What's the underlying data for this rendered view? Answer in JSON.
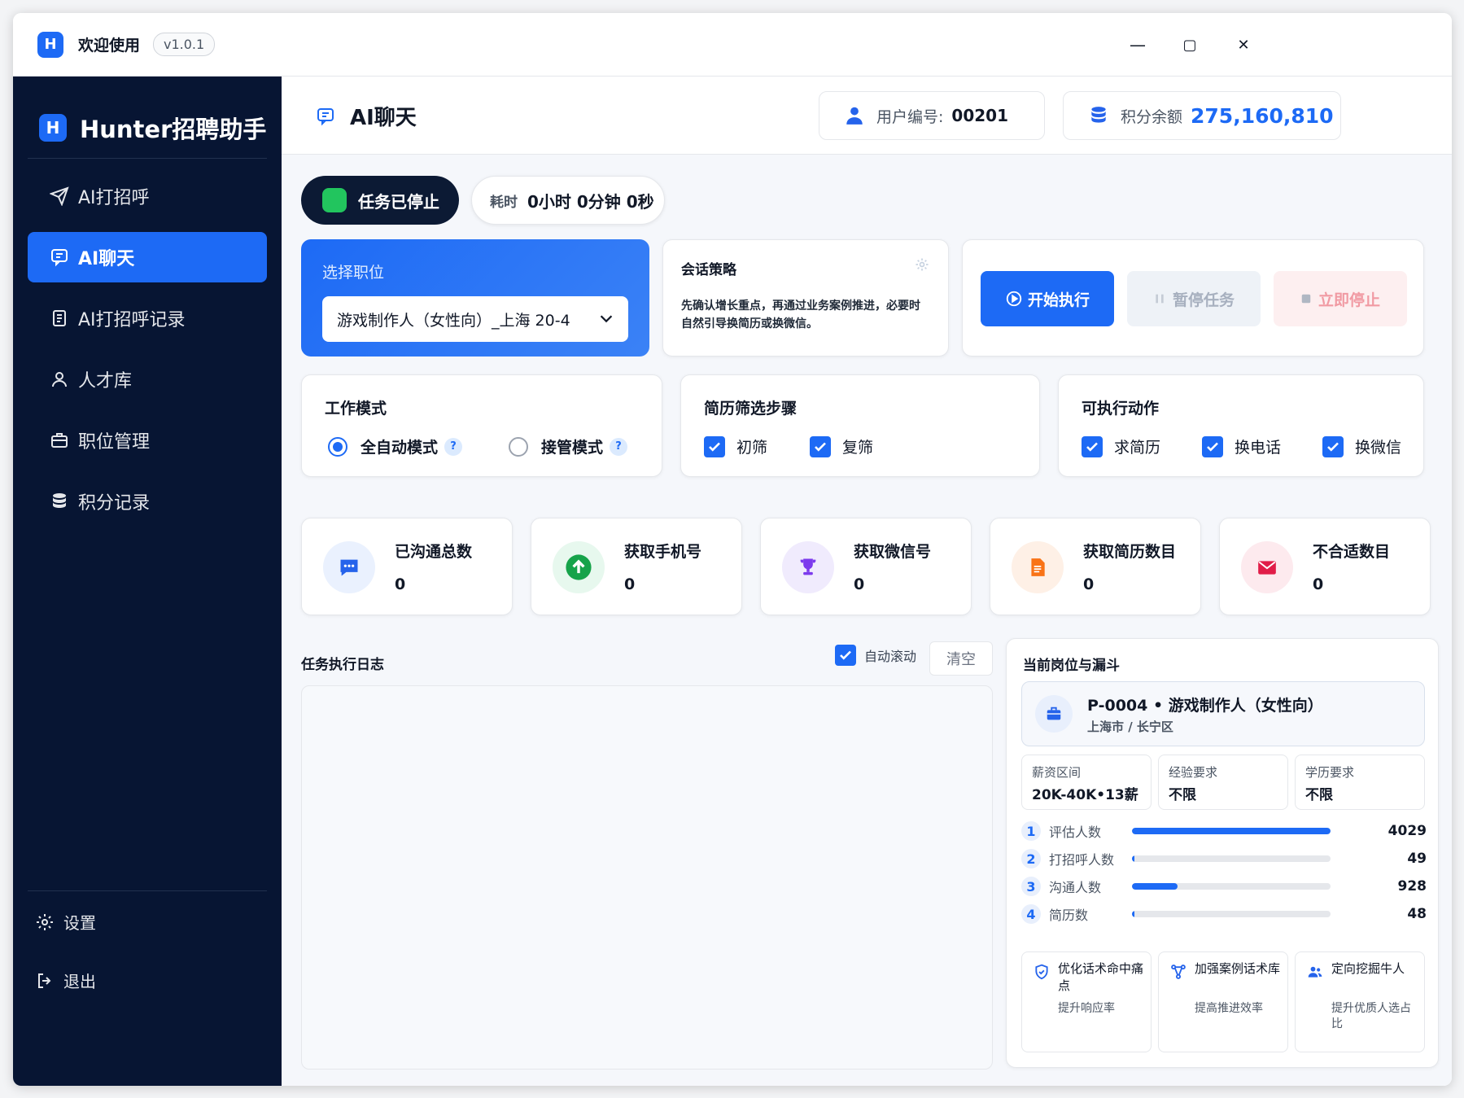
{
  "titlebar": {
    "title": "欢迎使用",
    "version": "v1.0.1",
    "minimize": "—",
    "maximize": "▢",
    "close": "✕"
  },
  "sidebar": {
    "brand": "Hunter招聘助手",
    "items": [
      {
        "label": "AI打招呼",
        "icon": "send-icon"
      },
      {
        "label": "AI聊天",
        "icon": "chat-icon"
      },
      {
        "label": "AI打招呼记录",
        "icon": "document-icon"
      },
      {
        "label": "人才库",
        "icon": "user-icon"
      },
      {
        "label": "职位管理",
        "icon": "briefcase-icon"
      },
      {
        "label": "积分记录",
        "icon": "database-icon"
      }
    ],
    "active_index": 1,
    "settings": "设置",
    "logout": "退出"
  },
  "header": {
    "title": "AI聊天",
    "user_label": "用户编号:",
    "user_id": "00201",
    "points_label": "积分余额",
    "points_value": "275,160,810"
  },
  "task": {
    "status": "任务已停止",
    "elapsed_label": "耗时",
    "elapsed_value": "0小时 0分钟 0秒"
  },
  "job_select": {
    "label": "选择职位",
    "value": "游戏制作人（女性向）_上海 20-4"
  },
  "strategy": {
    "title": "会话策略",
    "text": "先确认增长重点，再通过业务案例推进，必要时自然引导换简历或换微信。"
  },
  "actions": {
    "start": "开始执行",
    "pause": "暂停任务",
    "stop": "立即停止"
  },
  "work_mode": {
    "title": "工作模式",
    "options": [
      "全自动模式",
      "接管模式"
    ],
    "help": "?",
    "selected": 0
  },
  "resume_steps": {
    "title": "简历筛选步骤",
    "options": [
      "初筛",
      "复筛"
    ]
  },
  "exec_actions": {
    "title": "可执行动作",
    "options": [
      "求简历",
      "换电话",
      "换微信"
    ]
  },
  "stats": [
    {
      "title": "已沟通总数",
      "value": "0",
      "color": "#2563eb",
      "bg": "#eaf1fe"
    },
    {
      "title": "获取手机号",
      "value": "0",
      "color": "#16a34a",
      "bg": "#e7f8ee"
    },
    {
      "title": "获取微信号",
      "value": "0",
      "color": "#7c3aed",
      "bg": "#f0ebfd"
    },
    {
      "title": "获取简历数目",
      "value": "0",
      "color": "#f97316",
      "bg": "#fef0e6"
    },
    {
      "title": "不合适数目",
      "value": "0",
      "color": "#e11d48",
      "bg": "#fdeaee"
    }
  ],
  "log": {
    "title": "任务执行日志",
    "auto_scroll": "自动滚动",
    "clear": "清空"
  },
  "funnel": {
    "title": "当前岗位与漏斗",
    "job_title": "P-0004 • 游戏制作人（女性向）",
    "job_location": "上海市 / 长宁区",
    "meta": [
      {
        "label": "薪资区间",
        "value": "20K-40K•13薪"
      },
      {
        "label": "经验要求",
        "value": "不限"
      },
      {
        "label": "学历要求",
        "value": "不限"
      }
    ],
    "rows": [
      {
        "num": "1",
        "label": "评估人数",
        "value": "4029",
        "fraction": 1.0
      },
      {
        "num": "2",
        "label": "打招呼人数",
        "value": "49",
        "fraction": 0.012
      },
      {
        "num": "3",
        "label": "沟通人数",
        "value": "928",
        "fraction": 0.23
      },
      {
        "num": "4",
        "label": "简历数",
        "value": "48",
        "fraction": 0.012
      }
    ],
    "tips": [
      {
        "title": "优化话术命中痛点",
        "sub": "提升响应率",
        "icon": "shield-check-icon"
      },
      {
        "title": "加强案例话术库",
        "sub": "提高推进效率",
        "icon": "network-icon"
      },
      {
        "title": "定向挖掘牛人",
        "sub": "提升优质人选占比",
        "icon": "users-icon"
      }
    ]
  }
}
